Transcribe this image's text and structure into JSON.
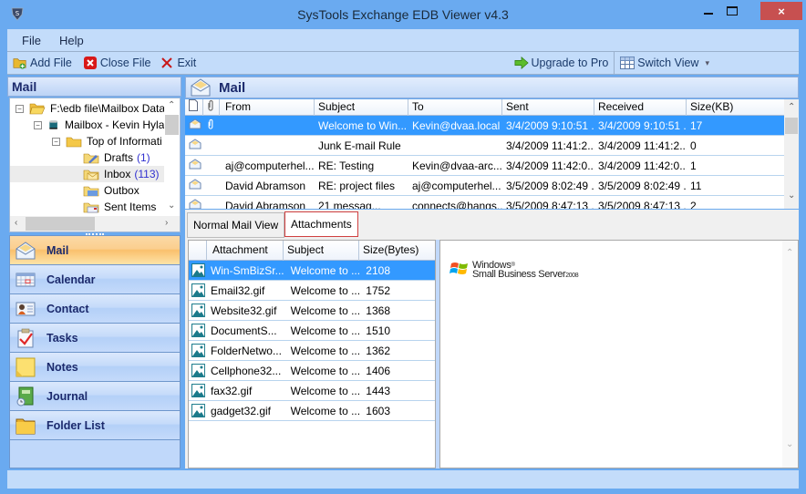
{
  "window": {
    "title": "SysTools Exchange EDB Viewer v4.3",
    "controls": {
      "minimize": "minimize",
      "maximize": "maximize",
      "close": "×"
    }
  },
  "menu": [
    "File",
    "Help"
  ],
  "toolbar": {
    "add_file": "Add File",
    "close_file": "Close File",
    "exit": "Exit",
    "upgrade": "Upgrade to Pro",
    "switch_view": "Switch View",
    "switch_view_caret": "▾"
  },
  "left_pane": {
    "header": "Mail",
    "tree": [
      {
        "label": "F:\\edb file\\Mailbox Data",
        "count": "",
        "icon": "open-folder-icon",
        "expander": "−"
      },
      {
        "label": "Mailbox - Kevin Hyla",
        "count": "",
        "icon": "database-icon",
        "expander": "−"
      },
      {
        "label": "Top of Informati",
        "count": "",
        "icon": "folder-icon",
        "expander": "−"
      },
      {
        "label": "Drafts",
        "count": "(1)",
        "icon": "drafts-folder-icon",
        "expander": ""
      },
      {
        "label": "Inbox",
        "count": "(113)",
        "icon": "inbox-folder-icon",
        "expander": "",
        "selected": true
      },
      {
        "label": "Outbox",
        "count": "",
        "icon": "outbox-folder-icon",
        "expander": ""
      },
      {
        "label": "Sent Items",
        "count": "",
        "icon": "sent-folder-icon",
        "expander": ""
      }
    ],
    "nav": [
      {
        "label": "Mail",
        "icon": "mail-icon",
        "active": true
      },
      {
        "label": "Calendar",
        "icon": "calendar-icon"
      },
      {
        "label": "Contact",
        "icon": "contact-icon"
      },
      {
        "label": "Tasks",
        "icon": "tasks-icon"
      },
      {
        "label": "Notes",
        "icon": "notes-icon"
      },
      {
        "label": "Journal",
        "icon": "journal-icon"
      },
      {
        "label": "Folder List",
        "icon": "folder-list-icon"
      }
    ]
  },
  "mail_list": {
    "header": "Mail",
    "columns": [
      "",
      "",
      "From",
      "Subject",
      "To",
      "Sent",
      "Received",
      "Size(KB)"
    ],
    "rows": [
      {
        "attach": true,
        "from": "",
        "subject": "Welcome to Win...",
        "to": "Kevin@dvaa.local",
        "sent": "3/4/2009 9:10:51 ...",
        "received": "3/4/2009 9:10:51 ...",
        "size": "17",
        "selected": true
      },
      {
        "attach": false,
        "from": "",
        "subject": "Junk E-mail Rule",
        "to": "",
        "sent": "3/4/2009 11:41:2...",
        "received": "3/4/2009 11:41:2...",
        "size": "0"
      },
      {
        "attach": false,
        "from": "aj@computerhel...",
        "subject": "RE: Testing",
        "to": "Kevin@dvaa-arc...",
        "sent": "3/4/2009 11:42:0...",
        "received": "3/4/2009 11:42:0...",
        "size": "1"
      },
      {
        "attach": false,
        "from": "David Abramson",
        "subject": "RE: project files",
        "to": "aj@computerhel...",
        "sent": "3/5/2009 8:02:49 ...",
        "received": "3/5/2009 8:02:49 ...",
        "size": "11"
      },
      {
        "attach": false,
        "from": "David Abramson",
        "subject": "21 messag...",
        "to": "connects@hangs...",
        "sent": "3/5/2009 8:47:13 ...",
        "received": "3/5/2009 8:47:13 ...",
        "size": "2"
      }
    ]
  },
  "tabs": [
    {
      "label": "Normal Mail View",
      "active": false
    },
    {
      "label": "Attachments",
      "active": true
    }
  ],
  "attachments": {
    "columns": [
      "",
      "Attachment",
      "Subject",
      "Size(Bytes)"
    ],
    "rows": [
      {
        "name": "Win-SmBizSr...",
        "subject": "Welcome to ...",
        "size": "2108",
        "selected": true
      },
      {
        "name": "Email32.gif",
        "subject": "Welcome to ...",
        "size": "1752"
      },
      {
        "name": "Website32.gif",
        "subject": "Welcome to ...",
        "size": "1368"
      },
      {
        "name": "DocumentS...",
        "subject": "Welcome to ...",
        "size": "1510"
      },
      {
        "name": "FolderNetwo...",
        "subject": "Welcome to ...",
        "size": "1362"
      },
      {
        "name": "Cellphone32...",
        "subject": "Welcome to ...",
        "size": "1406"
      },
      {
        "name": "fax32.gif",
        "subject": "Welcome to ...",
        "size": "1443"
      },
      {
        "name": "gadget32.gif",
        "subject": "Welcome to ...",
        "size": "1603"
      }
    ]
  },
  "preview": {
    "logo_line1": "Windows",
    "logo_mark": "®",
    "logo_line2": "Small Business Server",
    "logo_year": "2008"
  },
  "colors": {
    "selection": "#3399ff",
    "frame": "#6aaaf0",
    "nav_active": "#fac06c",
    "close_button": "#c75050"
  }
}
